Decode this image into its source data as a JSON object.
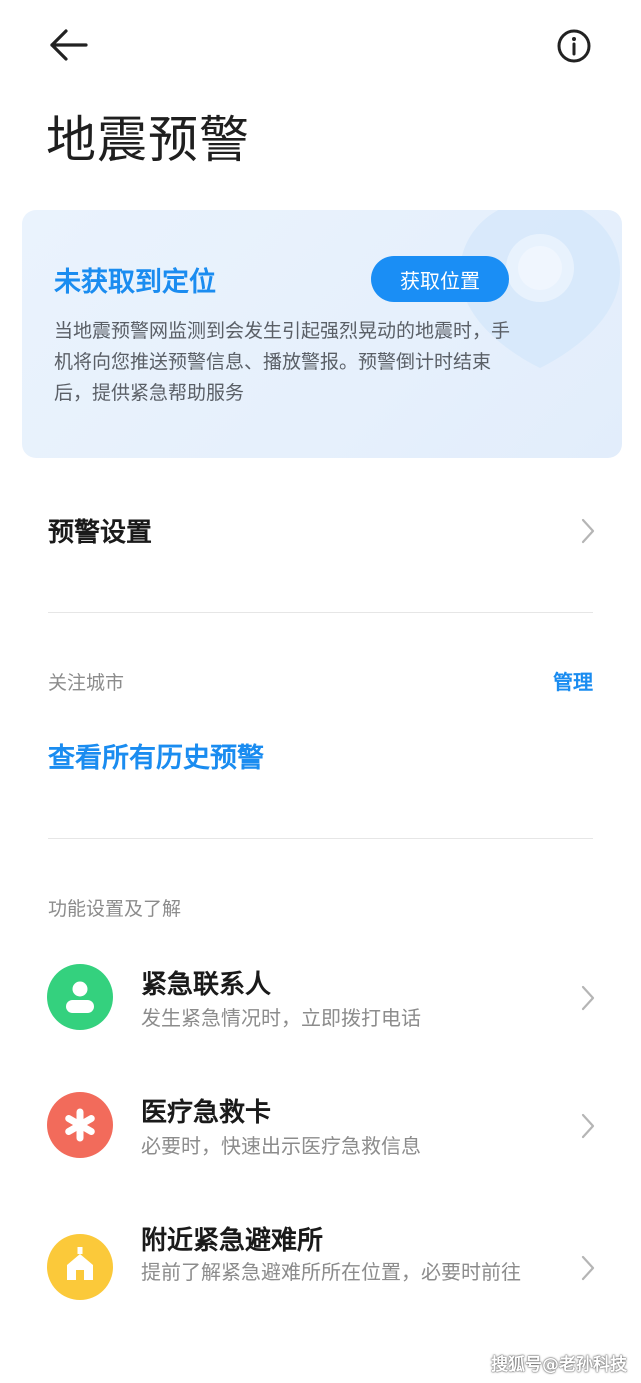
{
  "header": {
    "back_icon": "arrow-left-icon",
    "info_icon": "info-circle-icon",
    "title": "地震预警"
  },
  "location_card": {
    "title": "未获取到定位",
    "button_label": "获取位置",
    "description": "当地震预警网监测到会发生引起强烈晃动的地震时，手机将向您推送预警信息、播放警报。预警倒计时结束后，提供紧急帮助服务",
    "accent_color": "#1a8cf0",
    "background_color": "#e8f1fc"
  },
  "settings_row": {
    "label": "预警设置"
  },
  "followed_cities": {
    "label": "关注城市",
    "manage_label": "管理",
    "history_link": "查看所有历史预警"
  },
  "features": {
    "section_label": "功能设置及了解",
    "items": [
      {
        "title": "紧急联系人",
        "description": "发生紧急情况时，立即拨打电话",
        "icon": "person-icon",
        "color": "#34d17e"
      },
      {
        "title": "医疗急救卡",
        "description": "必要时，快速出示医疗急救信息",
        "icon": "asterisk-icon",
        "color": "#f26b5b"
      },
      {
        "title": "附近紧急避难所",
        "description": "提前了解紧急避难所所在位置，必要时前往",
        "icon": "house-icon",
        "color": "#fbc93a"
      }
    ]
  },
  "watermark": "搜狐号@老孙科技"
}
